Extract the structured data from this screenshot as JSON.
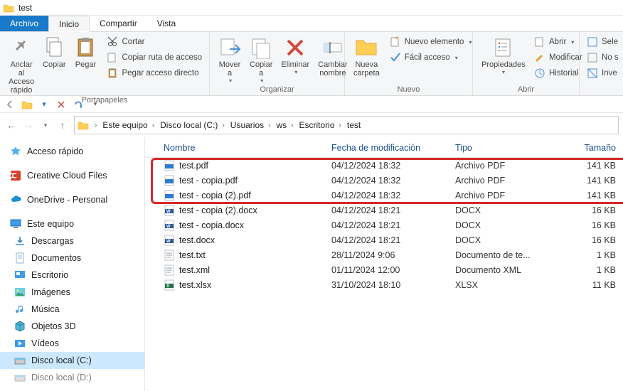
{
  "window": {
    "title": "test"
  },
  "tabs": {
    "archivo": "Archivo",
    "inicio": "Inicio",
    "compartir": "Compartir",
    "vista": "Vista"
  },
  "ribbon": {
    "anclar": "Anclar al\nAcceso rápido",
    "copiar": "Copiar",
    "pegar": "Pegar",
    "cortar": "Cortar",
    "copiar_ruta": "Copiar ruta de acceso",
    "pegar_directo": "Pegar acceso directo",
    "portapapeles": "Portapapeles",
    "mover_a": "Mover\na",
    "copiar_a": "Copiar\na",
    "eliminar": "Eliminar",
    "cambiar_nombre": "Cambiar\nnombre",
    "organizar": "Organizar",
    "nueva_carpeta": "Nueva\ncarpeta",
    "nuevo_elemento": "Nuevo elemento",
    "facil_acceso": "Fácil acceso",
    "nuevo": "Nuevo",
    "propiedades": "Propiedades",
    "abrir": "Abrir",
    "modificar": "Modificar",
    "historial": "Historial",
    "abrir_group": "Abrir",
    "sele": "Sele",
    "no_s": "No s",
    "inve": "Inve"
  },
  "breadcrumb": [
    "Este equipo",
    "Disco local (C:)",
    "Usuarios",
    "ws",
    "Escritorio",
    "test"
  ],
  "nav": {
    "acceso_rapido": "Acceso rápido",
    "ccf": "Creative Cloud Files",
    "onedrive": "OneDrive - Personal",
    "este_equipo": "Este equipo",
    "descargas": "Descargas",
    "documentos": "Documentos",
    "escritorio": "Escritorio",
    "imagenes": "Imágenes",
    "musica": "Música",
    "objetos3d": "Objetos 3D",
    "videos": "Vídeos",
    "disco_c": "Disco local (C:)",
    "disco_d": "Disco local (D:)"
  },
  "columns": {
    "nombre": "Nombre",
    "fecha": "Fecha de modificación",
    "tipo": "Tipo",
    "tamano": "Tamaño"
  },
  "files": [
    {
      "name": "test.pdf",
      "date": "04/12/2024 18:32",
      "type": "Archivo PDF",
      "size": "141 KB",
      "icon": "pdf"
    },
    {
      "name": "test - copia.pdf",
      "date": "04/12/2024 18:32",
      "type": "Archivo PDF",
      "size": "141 KB",
      "icon": "pdf"
    },
    {
      "name": "test - copia (2).pdf",
      "date": "04/12/2024 18:32",
      "type": "Archivo PDF",
      "size": "141 KB",
      "icon": "pdf"
    },
    {
      "name": "test - copia (2).docx",
      "date": "04/12/2024 18:21",
      "type": "DOCX",
      "size": "16 KB",
      "icon": "docx"
    },
    {
      "name": "test - copia.docx",
      "date": "04/12/2024 18:21",
      "type": "DOCX",
      "size": "16 KB",
      "icon": "docx"
    },
    {
      "name": "test.docx",
      "date": "04/12/2024 18:21",
      "type": "DOCX",
      "size": "16 KB",
      "icon": "docx"
    },
    {
      "name": "test.txt",
      "date": "28/11/2024 9:06",
      "type": "Documento de te...",
      "size": "1 KB",
      "icon": "txt"
    },
    {
      "name": "test.xml",
      "date": "01/11/2024 12:00",
      "type": "Documento XML",
      "size": "1 KB",
      "icon": "txt"
    },
    {
      "name": "test.xlsx",
      "date": "31/10/2024 18:10",
      "type": "XLSX",
      "size": "11 KB",
      "icon": "xlsx"
    }
  ]
}
